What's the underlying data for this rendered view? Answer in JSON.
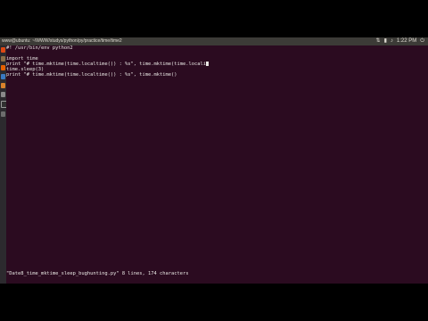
{
  "topbar": {
    "title": "www@ubuntu: ~/WWW/studys/python/py/practice/time/time2",
    "clock": "1:22 PM",
    "status_icons": [
      "network-icon",
      "battery-icon",
      "volume-icon",
      "power-icon"
    ]
  },
  "launcher": {
    "icons": [
      "dash-icon",
      "files-icon",
      "firefox-icon",
      "office-icon",
      "software-icon",
      "settings-icon",
      "terminal-icon",
      "trash-icon"
    ]
  },
  "editor": {
    "lines": [
      "#! /usr/bin/env python2",
      "",
      "import time",
      "print \"# time.mktime(time.localtime()) : %s\", time.mktime(time.locali",
      "time.sleep(3)",
      "print \"# time.mktime(time.localtime()) : %s\", time.mktime()"
    ],
    "status_line": "\"Date8_time_mktime_sleep_bughunting.py\" 8 lines, 174 characters"
  },
  "colors": {
    "terminal_bg": "#2b0b20",
    "terminal_fg": "#e8e6e3",
    "topbar_bg": "#3c3b37",
    "launcher_bg": "#2c2a2e"
  }
}
